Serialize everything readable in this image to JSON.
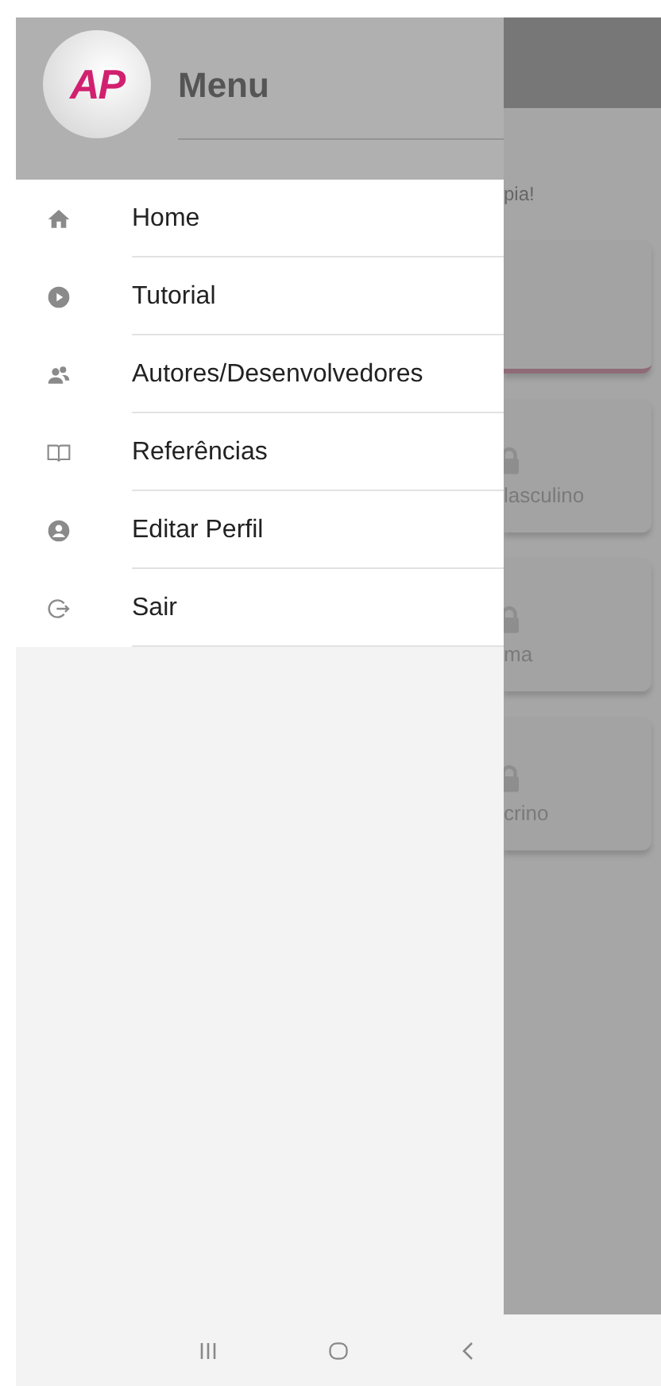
{
  "drawer": {
    "title": "Menu",
    "logo": "AP",
    "items": [
      {
        "kind": "home",
        "label": "Home"
      },
      {
        "kind": "play",
        "label": "Tutorial"
      },
      {
        "kind": "people",
        "label": "Autores/Desenvolvedores"
      },
      {
        "kind": "book",
        "label": "Referências"
      },
      {
        "kind": "profile",
        "label": "Editar Perfil"
      },
      {
        "kind": "exit",
        "label": "Sair"
      }
    ]
  },
  "background_page": {
    "greeting": "pia!",
    "cards": [
      {
        "kind": "plain"
      },
      {
        "kind": "locked",
        "label": "lasculino"
      },
      {
        "kind": "locked",
        "label": "ma"
      },
      {
        "kind": "locked",
        "label": "crino"
      }
    ]
  }
}
